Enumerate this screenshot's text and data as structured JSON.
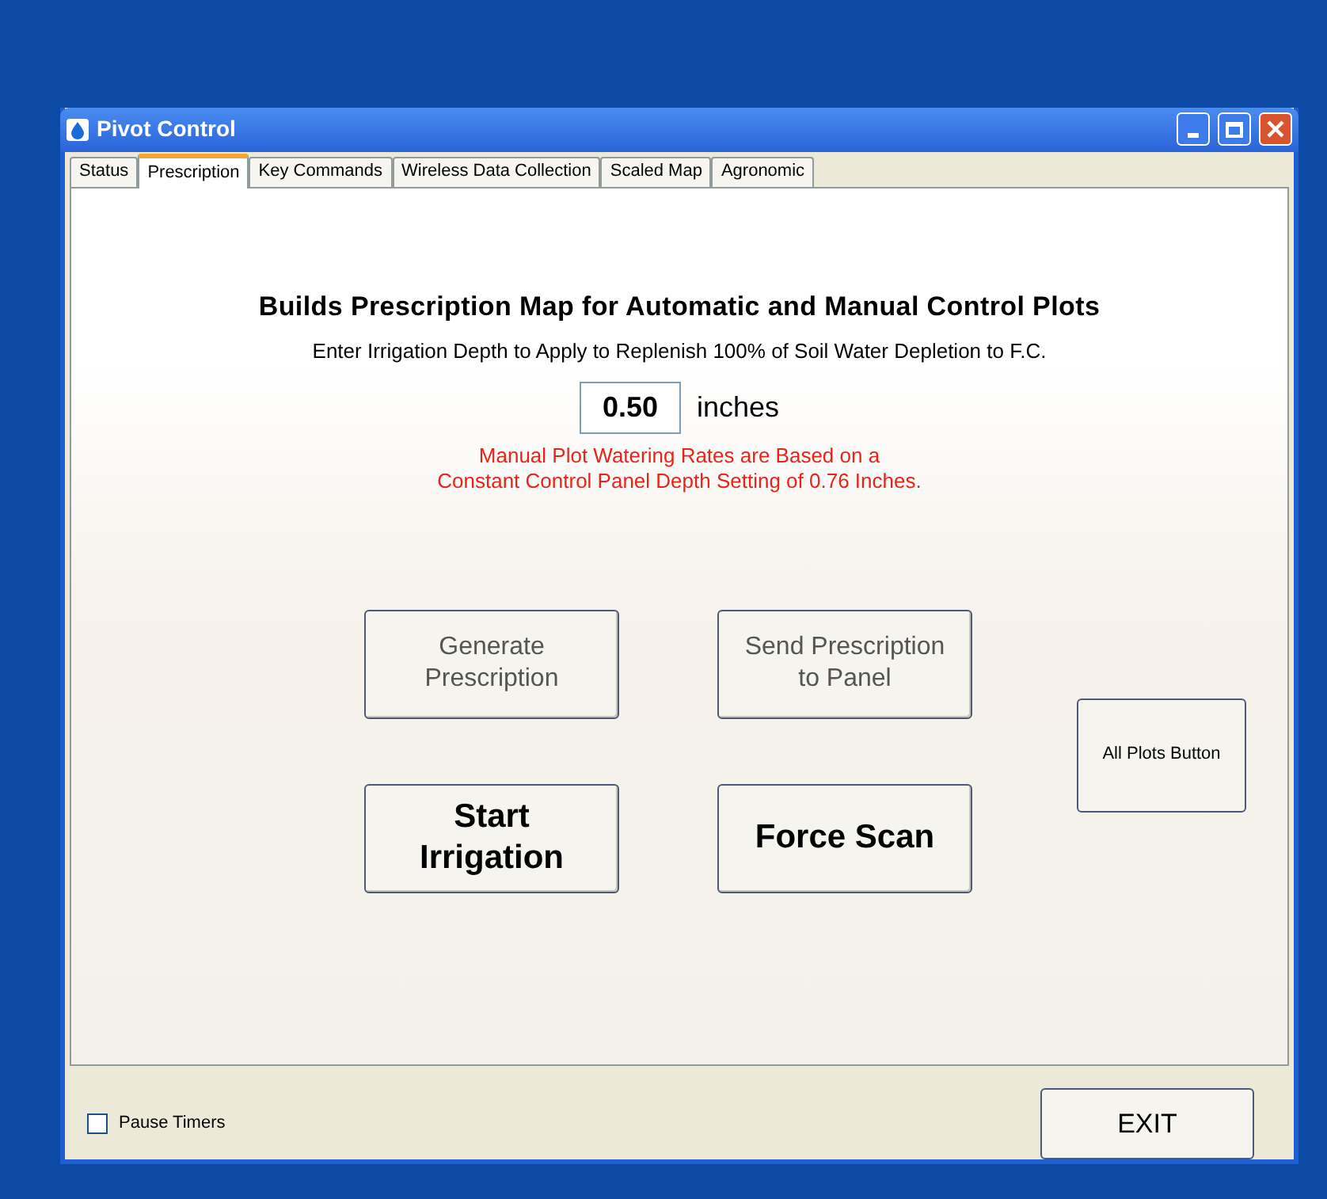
{
  "window": {
    "title": "Pivot Control"
  },
  "tabs": [
    {
      "label": "Status",
      "selected": false
    },
    {
      "label": "Prescription",
      "selected": true
    },
    {
      "label": "Key Commands",
      "selected": false
    },
    {
      "label": "Wireless Data Collection",
      "selected": false
    },
    {
      "label": "Scaled Map",
      "selected": false
    },
    {
      "label": "Agronomic",
      "selected": false
    }
  ],
  "heading": "Builds Prescription Map for Automatic and Manual Control Plots",
  "instruction": "Enter Irrigation Depth to Apply to Replenish 100% of Soil Water Depletion to F.C.",
  "depth": {
    "value": "0.50",
    "unit": "inches"
  },
  "notice": [
    "Manual Plot Watering Rates are Based on a",
    "Constant Control Panel Depth Setting of 0.76 Inches."
  ],
  "buttons": [
    {
      "label": "Generate Prescription",
      "kind": "plain"
    },
    {
      "label": "Send Prescription to Panel",
      "kind": "plain"
    },
    {
      "label": "Start Irrigation",
      "kind": "bold"
    },
    {
      "label": "Force Scan",
      "kind": "bold"
    }
  ],
  "side_button": "All Plots Button",
  "pause_timers": {
    "label": "Pause Timers",
    "checked": false
  },
  "exit_button": "EXIT"
}
